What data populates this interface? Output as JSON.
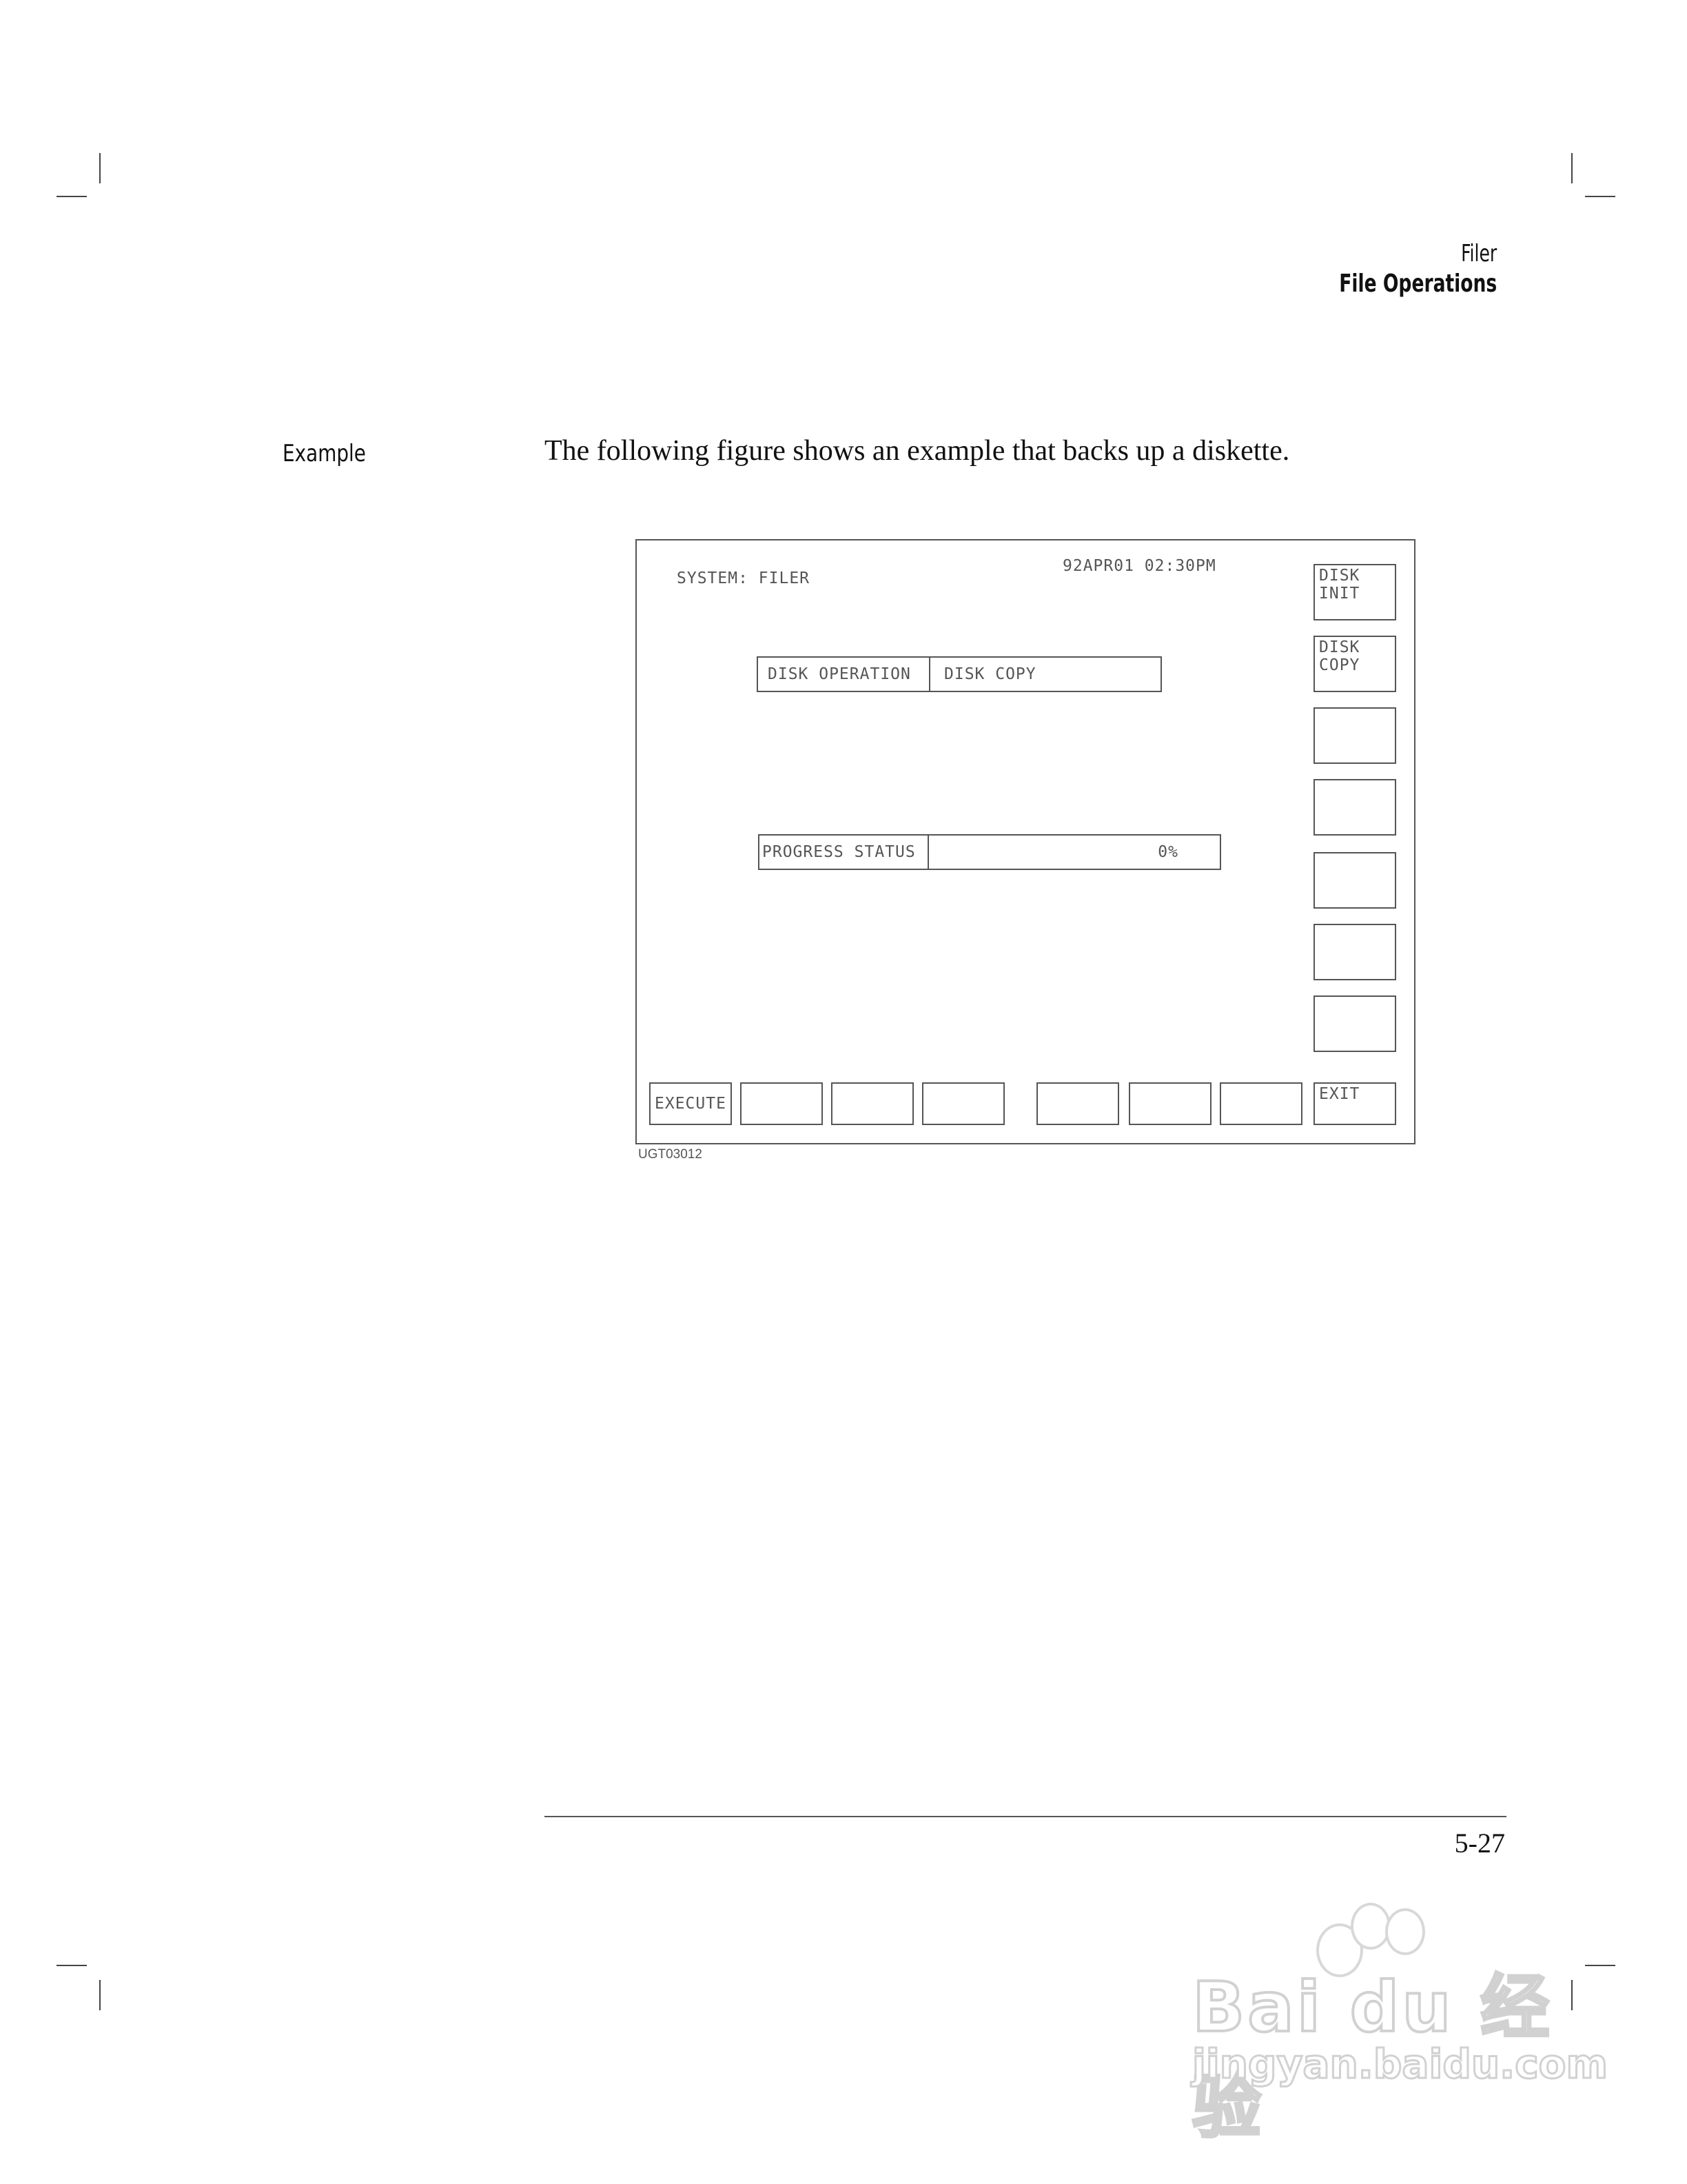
{
  "header": {
    "chapter": "Filer",
    "section": "File Operations"
  },
  "side_label": "Example",
  "intro_text": "The following figure shows an example that backs up a diskette.",
  "figure": {
    "system_label": "SYSTEM: FILER",
    "timestamp": "92APR01 02:30PM",
    "disk_operation": {
      "label": "DISK OPERATION",
      "value": "DISK COPY"
    },
    "progress_status": {
      "label": "PROGRESS STATUS",
      "value": "0%"
    },
    "side_softkeys": [
      {
        "line1": "DISK",
        "line2": "INIT"
      },
      {
        "line1": "DISK",
        "line2": "COPY"
      },
      {
        "line1": "",
        "line2": ""
      },
      {
        "line1": "",
        "line2": ""
      },
      {
        "line1": "",
        "line2": ""
      },
      {
        "line1": "",
        "line2": ""
      },
      {
        "line1": "",
        "line2": ""
      }
    ],
    "bottom_softkeys": [
      "EXECUTE",
      "",
      "",
      "",
      "",
      "",
      "",
      "EXIT"
    ],
    "figure_id": "UGT03012"
  },
  "page_number": "5-27",
  "watermark": {
    "brand": "Bai du 经验",
    "url": "jingyan.baidu.com"
  }
}
